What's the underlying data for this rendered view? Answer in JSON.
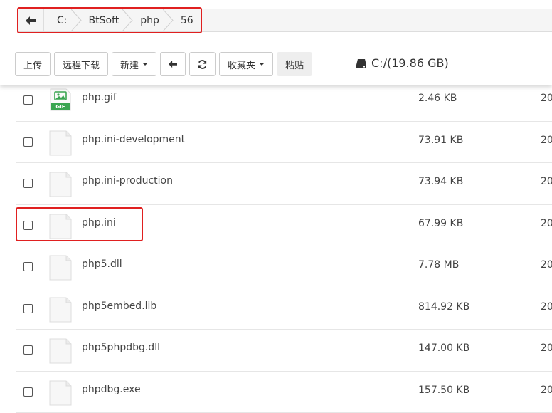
{
  "breadcrumb": {
    "segments": [
      "C:",
      "BtSoft",
      "php",
      "56"
    ]
  },
  "toolbar": {
    "upload": "上传",
    "remote_download": "远程下载",
    "new": "新建",
    "favorites": "收藏夹",
    "paste": "粘贴"
  },
  "disk": {
    "label": "C:/(19.86 GB)"
  },
  "files": [
    {
      "name": "php.gif",
      "size": "2.46 KB",
      "date": "20",
      "type": "gif",
      "icon_label": "GIF"
    },
    {
      "name": "php.ini-development",
      "size": "73.91 KB",
      "date": "20",
      "type": "file"
    },
    {
      "name": "php.ini-production",
      "size": "73.94 KB",
      "date": "20",
      "type": "file"
    },
    {
      "name": "php.ini",
      "size": "67.99 KB",
      "date": "20",
      "type": "file"
    },
    {
      "name": "php5.dll",
      "size": "7.78 MB",
      "date": "20",
      "type": "file"
    },
    {
      "name": "php5embed.lib",
      "size": "814.92 KB",
      "date": "20",
      "type": "file"
    },
    {
      "name": "php5phpdbg.dll",
      "size": "147.00 KB",
      "date": "20",
      "type": "file"
    },
    {
      "name": "phpdbg.exe",
      "size": "157.50 KB",
      "date": "20",
      "type": "file"
    }
  ],
  "colors": {
    "highlight": "#e02020",
    "gif_green": "#3aa551"
  }
}
